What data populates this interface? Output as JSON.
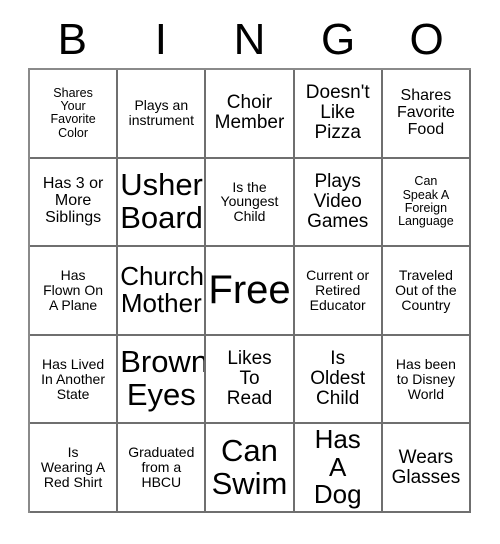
{
  "header": {
    "letters": [
      "B",
      "I",
      "N",
      "G",
      "O"
    ]
  },
  "grid": {
    "rows": 5,
    "columns": 5,
    "cells": [
      {
        "text": "Shares\nYour\nFavorite\nColor",
        "size": "fs-xxs"
      },
      {
        "text": "Plays an\ninstrument",
        "size": "fs-xs"
      },
      {
        "text": "Choir\nMember",
        "size": "fs-md"
      },
      {
        "text": "Doesn't\nLike\nPizza",
        "size": "fs-md"
      },
      {
        "text": "Shares\nFavorite\nFood",
        "size": "fs-sm"
      },
      {
        "text": "Has 3 or\nMore\nSiblings",
        "size": "fs-sm"
      },
      {
        "text": "Usher\nBoard",
        "size": "fs-xl"
      },
      {
        "text": "Is the\nYoungest\nChild",
        "size": "fs-xs"
      },
      {
        "text": "Plays\nVideo\nGames",
        "size": "fs-md"
      },
      {
        "text": "Can\nSpeak A\nForeign\nLanguage",
        "size": "fs-xxs"
      },
      {
        "text": "Has\nFlown On\nA Plane",
        "size": "fs-xs"
      },
      {
        "text": "Church\nMother",
        "size": "fs-lg"
      },
      {
        "text": "Free!",
        "size": "fs-xxl"
      },
      {
        "text": "Current or\nRetired\nEducator",
        "size": "fs-xs"
      },
      {
        "text": "Traveled\nOut of the\nCountry",
        "size": "fs-xs"
      },
      {
        "text": "Has Lived\nIn Another\nState",
        "size": "fs-xs"
      },
      {
        "text": "Brown\nEyes",
        "size": "fs-xl"
      },
      {
        "text": "Likes\nTo\nRead",
        "size": "fs-md"
      },
      {
        "text": "Is\nOldest\nChild",
        "size": "fs-md"
      },
      {
        "text": "Has been\nto Disney\nWorld",
        "size": "fs-xs"
      },
      {
        "text": "Is\nWearing A\nRed Shirt",
        "size": "fs-xs"
      },
      {
        "text": "Graduated\nfrom a\nHBCU",
        "size": "fs-xs"
      },
      {
        "text": "Can\nSwim",
        "size": "fs-xl"
      },
      {
        "text": "Has\nA\nDog",
        "size": "fs-lg"
      },
      {
        "text": "Wears\nGlasses",
        "size": "fs-md"
      }
    ]
  },
  "colors": {
    "background": "#ffffff",
    "text": "#000000",
    "border": "#6f6f6f"
  }
}
